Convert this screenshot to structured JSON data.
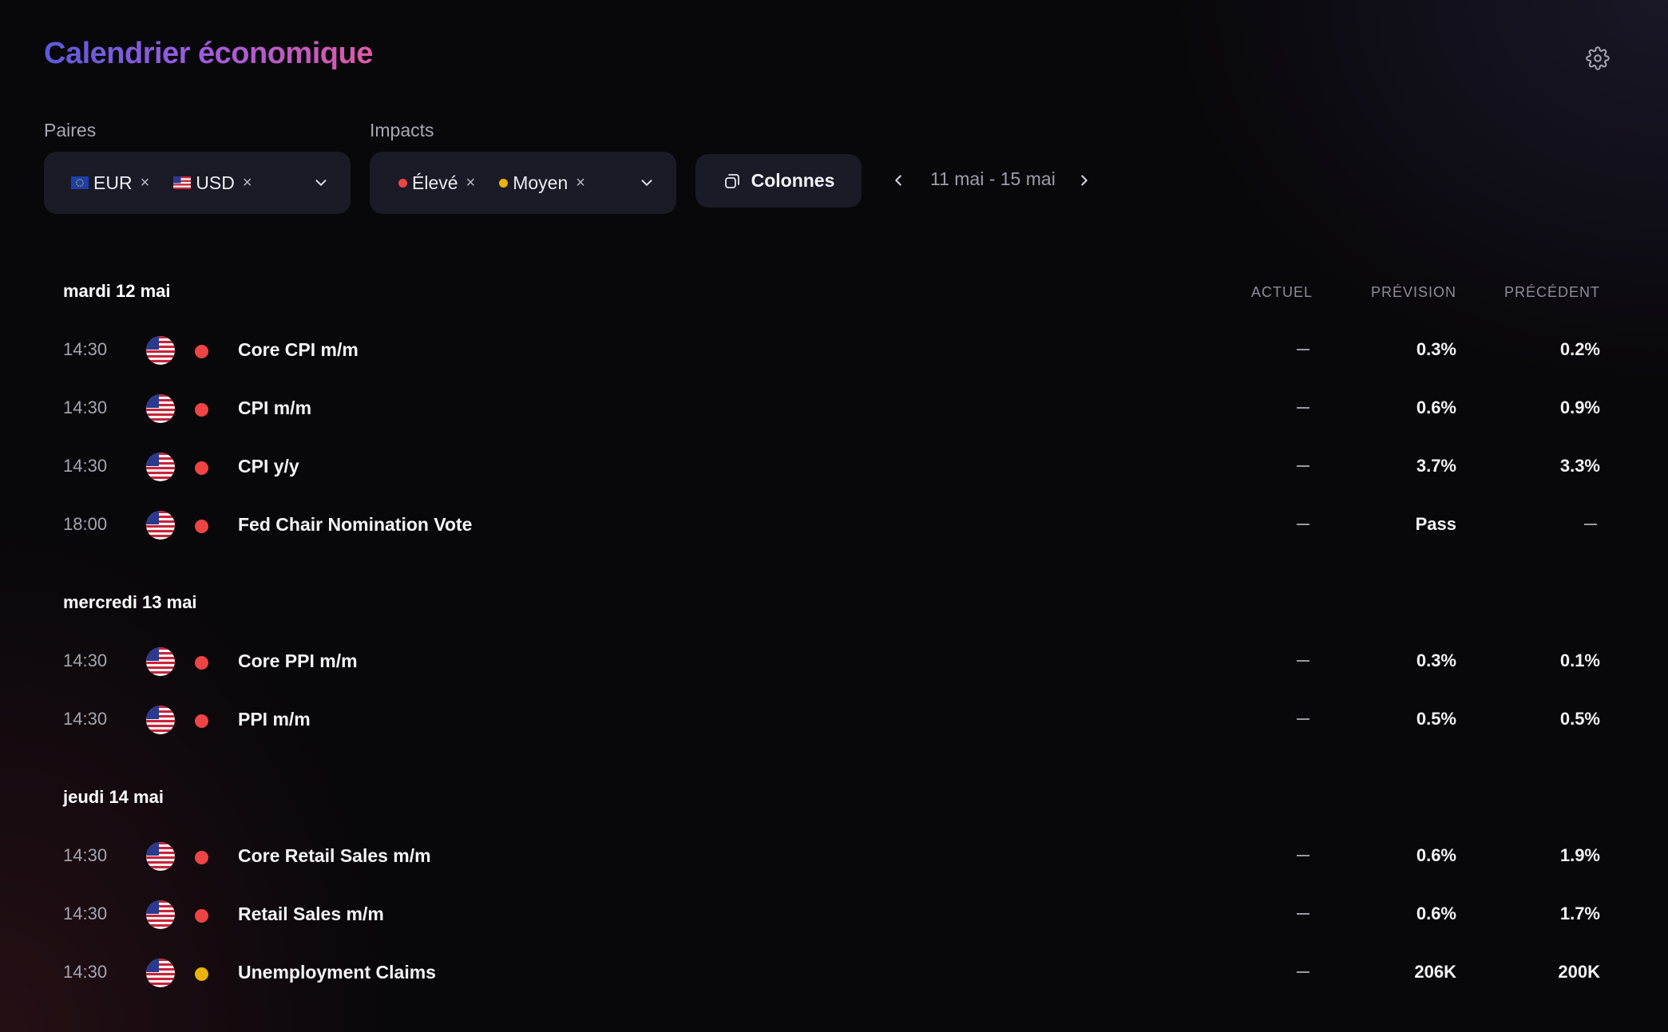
{
  "header": {
    "title": "Calendrier économique"
  },
  "filters": {
    "pairs_label": "Paires",
    "pairs": [
      {
        "label": "EUR",
        "flag": "eu-flag"
      },
      {
        "label": "USD",
        "flag": "us-flag"
      }
    ],
    "impacts_label": "Impacts",
    "impacts": [
      {
        "label": "Élevé",
        "color": "#ee4444"
      },
      {
        "label": "Moyen",
        "color": "#e9b30c"
      }
    ],
    "columns_button": "Colonnes",
    "date_range": "11 mai - 15 mai",
    "remove_glyph": "×"
  },
  "columns": {
    "actual": "ACTUEL",
    "forecast": "PRÉVISION",
    "previous": "PRÉCÉDENT"
  },
  "colors": {
    "high": "#ee4444",
    "medium": "#e9b30c",
    "accent_start": "#5b5ad8",
    "accent_end": "#e05aa8"
  },
  "days": [
    {
      "label": "mardi 12 mai",
      "events": [
        {
          "time": "14:30",
          "country": "us-flag",
          "impact": "high",
          "name": "Core CPI m/m",
          "actual": "—",
          "forecast": "0.3%",
          "previous": "0.2%"
        },
        {
          "time": "14:30",
          "country": "us-flag",
          "impact": "high",
          "name": "CPI m/m",
          "actual": "—",
          "forecast": "0.6%",
          "previous": "0.9%"
        },
        {
          "time": "14:30",
          "country": "us-flag",
          "impact": "high",
          "name": "CPI y/y",
          "actual": "—",
          "forecast": "3.7%",
          "previous": "3.3%"
        },
        {
          "time": "18:00",
          "country": "us-flag",
          "impact": "high",
          "name": "Fed Chair Nomination Vote",
          "actual": "—",
          "forecast": "Pass",
          "previous": "—"
        }
      ]
    },
    {
      "label": "mercredi 13 mai",
      "events": [
        {
          "time": "14:30",
          "country": "us-flag",
          "impact": "high",
          "name": "Core PPI m/m",
          "actual": "—",
          "forecast": "0.3%",
          "previous": "0.1%"
        },
        {
          "time": "14:30",
          "country": "us-flag",
          "impact": "high",
          "name": "PPI m/m",
          "actual": "—",
          "forecast": "0.5%",
          "previous": "0.5%"
        }
      ]
    },
    {
      "label": "jeudi 14 mai",
      "events": [
        {
          "time": "14:30",
          "country": "us-flag",
          "impact": "high",
          "name": "Core Retail Sales m/m",
          "actual": "—",
          "forecast": "0.6%",
          "previous": "1.9%"
        },
        {
          "time": "14:30",
          "country": "us-flag",
          "impact": "high",
          "name": "Retail Sales m/m",
          "actual": "—",
          "forecast": "0.6%",
          "previous": "1.7%"
        },
        {
          "time": "14:30",
          "country": "us-flag",
          "impact": "medium",
          "name": "Unemployment Claims",
          "actual": "—",
          "forecast": "206K",
          "previous": "200K"
        }
      ]
    }
  ]
}
